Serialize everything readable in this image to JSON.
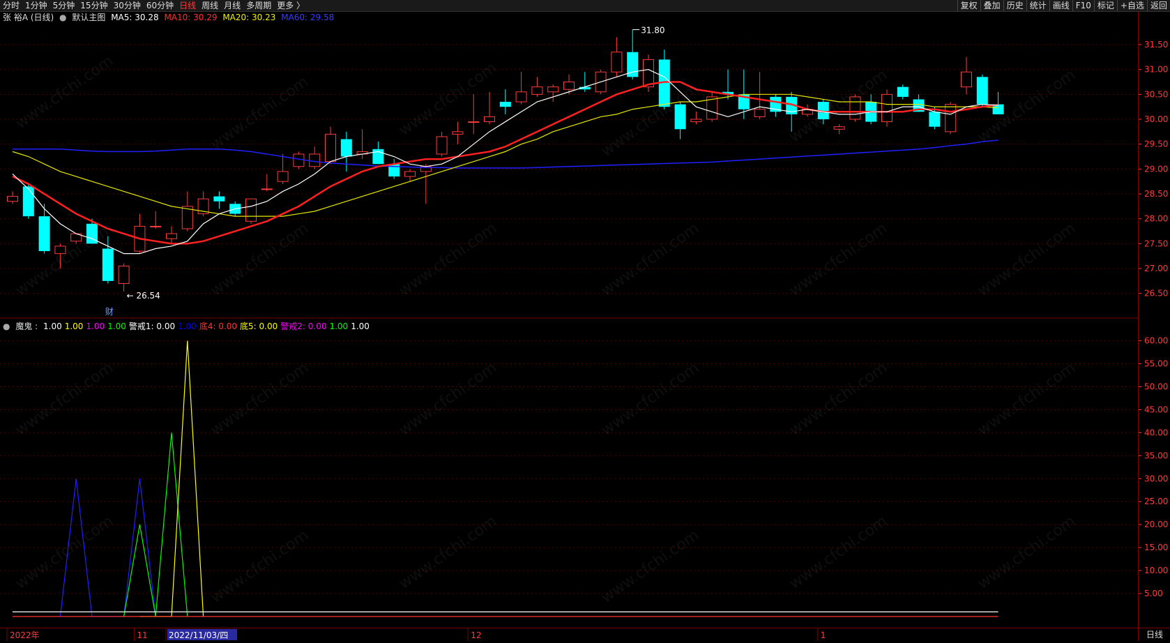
{
  "toolbar": {
    "left_tabs": [
      "分时",
      "1分钟",
      "5分钟",
      "15分钟",
      "30分钟",
      "60分钟",
      "日线",
      "周线",
      "月线",
      "多周期",
      "更多 〉"
    ],
    "active_tab": "日线",
    "right_buttons": [
      "复权",
      "叠加",
      "历史",
      "统计",
      "画线",
      "F10",
      "标记",
      "+自选",
      "返回"
    ]
  },
  "main_legend": {
    "stock": "张 裕A (日线)",
    "template": "默认主图",
    "ma5": "MA5: 30.28",
    "ma10": "MA10: 30.29",
    "ma20": "MA20: 30.23",
    "ma60": "MA60: 29.58"
  },
  "indicator_legend": {
    "name": "魔鬼 :",
    "items": [
      {
        "text": "1.00",
        "color": "#ffffff"
      },
      {
        "text": "1.00",
        "color": "#ffff00"
      },
      {
        "text": "1.00",
        "color": "#ff00ff"
      },
      {
        "text": "1.00",
        "color": "#00ff00"
      },
      {
        "text": "警戒1: 0.00",
        "color": "#ffffff"
      },
      {
        "text": "1.00",
        "color": "#0000ff"
      },
      {
        "text": "底4: 0.00",
        "color": "#ff3333"
      },
      {
        "text": "底5: 0.00",
        "color": "#ffff00"
      },
      {
        "text": "警戒2: 0.00",
        "color": "#ff00ff"
      },
      {
        "text": "1.00",
        "color": "#00ff00"
      },
      {
        "text": "1.00",
        "color": "#ffffff"
      }
    ]
  },
  "colors": {
    "up": "#ff3b3b",
    "down": "#00ffff",
    "ma5": "#ffffff",
    "ma10": "#ff2020",
    "ma20": "#e8e800",
    "ma60": "#2020ff",
    "grid": "#5a0000",
    "axis_text": "#ff3b3b"
  },
  "annotations": {
    "high": "31.80",
    "low": "26.54",
    "fin_marker": "财"
  },
  "watermark": "www.cfchi.com",
  "chart_data": [
    {
      "type": "candlestick",
      "title": "张 裕A (日线)",
      "ylim": [
        26.3,
        31.85
      ],
      "y_ticks": [
        "31.50",
        "31.00",
        "30.50",
        "30.00",
        "29.50",
        "29.00",
        "28.50",
        "28.00",
        "27.50",
        "27.00",
        "26.50"
      ],
      "candles": [
        {
          "o": 28.35,
          "h": 28.55,
          "l": 28.3,
          "c": 28.45
        },
        {
          "o": 28.65,
          "h": 28.7,
          "l": 28.0,
          "c": 28.05
        },
        {
          "o": 28.05,
          "h": 28.3,
          "l": 27.3,
          "c": 27.35
        },
        {
          "o": 27.3,
          "h": 27.5,
          "l": 27.0,
          "c": 27.45
        },
        {
          "o": 27.55,
          "h": 27.7,
          "l": 27.5,
          "c": 27.7
        },
        {
          "o": 27.9,
          "h": 28.0,
          "l": 27.5,
          "c": 27.5
        },
        {
          "o": 27.4,
          "h": 27.65,
          "l": 26.7,
          "c": 26.75
        },
        {
          "o": 26.7,
          "h": 27.1,
          "l": 26.54,
          "c": 27.05
        },
        {
          "o": 27.35,
          "h": 28.1,
          "l": 27.3,
          "c": 27.85
        },
        {
          "o": 27.85,
          "h": 28.15,
          "l": 27.8,
          "c": 27.85
        },
        {
          "o": 27.6,
          "h": 27.85,
          "l": 27.5,
          "c": 27.7
        },
        {
          "o": 27.8,
          "h": 28.55,
          "l": 27.75,
          "c": 28.25
        },
        {
          "o": 28.1,
          "h": 28.55,
          "l": 28.05,
          "c": 28.4
        },
        {
          "o": 28.45,
          "h": 28.55,
          "l": 28.2,
          "c": 28.35
        },
        {
          "o": 28.3,
          "h": 28.35,
          "l": 28.05,
          "c": 28.1
        },
        {
          "o": 27.95,
          "h": 28.4,
          "l": 27.9,
          "c": 28.4
        },
        {
          "o": 28.6,
          "h": 28.9,
          "l": 28.55,
          "c": 28.6
        },
        {
          "o": 28.75,
          "h": 29.3,
          "l": 28.7,
          "c": 28.95
        },
        {
          "o": 29.05,
          "h": 29.35,
          "l": 29.0,
          "c": 29.3
        },
        {
          "o": 29.05,
          "h": 29.45,
          "l": 29.0,
          "c": 29.3
        },
        {
          "o": 29.15,
          "h": 29.85,
          "l": 29.1,
          "c": 29.7
        },
        {
          "o": 29.6,
          "h": 29.75,
          "l": 28.95,
          "c": 29.25
        },
        {
          "o": 29.3,
          "h": 29.8,
          "l": 29.2,
          "c": 29.35
        },
        {
          "o": 29.4,
          "h": 29.55,
          "l": 29.1,
          "c": 29.1
        },
        {
          "o": 29.1,
          "h": 29.2,
          "l": 28.8,
          "c": 28.85
        },
        {
          "o": 28.85,
          "h": 29.0,
          "l": 28.75,
          "c": 28.95
        },
        {
          "o": 28.95,
          "h": 29.1,
          "l": 28.3,
          "c": 29.05
        },
        {
          "o": 29.3,
          "h": 29.75,
          "l": 29.25,
          "c": 29.65
        },
        {
          "o": 29.7,
          "h": 29.95,
          "l": 29.5,
          "c": 29.75
        },
        {
          "o": 29.95,
          "h": 30.5,
          "l": 29.7,
          "c": 29.95
        },
        {
          "o": 29.95,
          "h": 30.55,
          "l": 29.9,
          "c": 30.05
        },
        {
          "o": 30.35,
          "h": 30.6,
          "l": 30.1,
          "c": 30.25
        },
        {
          "o": 30.35,
          "h": 30.95,
          "l": 30.3,
          "c": 30.55
        },
        {
          "o": 30.5,
          "h": 30.85,
          "l": 30.45,
          "c": 30.65
        },
        {
          "o": 30.55,
          "h": 30.7,
          "l": 30.35,
          "c": 30.65
        },
        {
          "o": 30.6,
          "h": 30.9,
          "l": 30.5,
          "c": 30.75
        },
        {
          "o": 30.65,
          "h": 30.95,
          "l": 30.55,
          "c": 30.6
        },
        {
          "o": 30.55,
          "h": 31.0,
          "l": 30.5,
          "c": 30.95
        },
        {
          "o": 30.95,
          "h": 31.65,
          "l": 30.85,
          "c": 31.35
        },
        {
          "o": 31.35,
          "h": 31.8,
          "l": 30.8,
          "c": 30.85
        },
        {
          "o": 30.65,
          "h": 31.3,
          "l": 30.55,
          "c": 31.2
        },
        {
          "o": 31.2,
          "h": 31.4,
          "l": 30.2,
          "c": 30.25
        },
        {
          "o": 30.3,
          "h": 30.35,
          "l": 29.6,
          "c": 29.8
        },
        {
          "o": 29.95,
          "h": 30.15,
          "l": 29.9,
          "c": 30.0
        },
        {
          "o": 30.0,
          "h": 30.55,
          "l": 29.95,
          "c": 30.45
        },
        {
          "o": 30.55,
          "h": 31.0,
          "l": 30.4,
          "c": 30.5
        },
        {
          "o": 30.5,
          "h": 31.0,
          "l": 30.0,
          "c": 30.2
        },
        {
          "o": 30.05,
          "h": 30.95,
          "l": 30.0,
          "c": 30.2
        },
        {
          "o": 30.45,
          "h": 30.5,
          "l": 30.05,
          "c": 30.15
        },
        {
          "o": 30.45,
          "h": 30.55,
          "l": 29.75,
          "c": 30.1
        },
        {
          "o": 30.1,
          "h": 30.3,
          "l": 30.05,
          "c": 30.2
        },
        {
          "o": 30.35,
          "h": 30.4,
          "l": 29.9,
          "c": 30.0
        },
        {
          "o": 29.8,
          "h": 29.9,
          "l": 29.7,
          "c": 29.85
        },
        {
          "o": 30.0,
          "h": 30.5,
          "l": 29.95,
          "c": 30.45
        },
        {
          "o": 30.35,
          "h": 30.5,
          "l": 29.9,
          "c": 29.95
        },
        {
          "o": 29.95,
          "h": 30.6,
          "l": 29.85,
          "c": 30.5
        },
        {
          "o": 30.65,
          "h": 30.7,
          "l": 30.4,
          "c": 30.45
        },
        {
          "o": 30.4,
          "h": 30.5,
          "l": 30.15,
          "c": 30.15
        },
        {
          "o": 30.15,
          "h": 30.25,
          "l": 29.8,
          "c": 29.85
        },
        {
          "o": 29.75,
          "h": 30.35,
          "l": 29.7,
          "c": 30.3
        },
        {
          "o": 30.65,
          "h": 31.25,
          "l": 30.5,
          "c": 30.95
        },
        {
          "o": 30.85,
          "h": 30.9,
          "l": 30.25,
          "c": 30.3
        },
        {
          "o": 30.3,
          "h": 30.55,
          "l": 30.1,
          "c": 30.1
        }
      ],
      "ma5": [
        28.9,
        28.6,
        28.2,
        27.9,
        27.7,
        27.6,
        27.45,
        27.3,
        27.3,
        27.4,
        27.45,
        27.55,
        27.9,
        28.1,
        28.2,
        28.25,
        28.35,
        28.55,
        28.7,
        28.9,
        29.15,
        29.25,
        29.3,
        29.35,
        29.25,
        29.1,
        29.05,
        29.1,
        29.25,
        29.5,
        29.75,
        29.95,
        30.15,
        30.35,
        30.45,
        30.55,
        30.65,
        30.75,
        30.85,
        30.95,
        31.0,
        30.85,
        30.55,
        30.25,
        30.15,
        30.05,
        30.15,
        30.25,
        30.2,
        30.15,
        30.2,
        30.15,
        30.1,
        30.1,
        30.15,
        30.15,
        30.25,
        30.25,
        30.15,
        30.1,
        30.25,
        30.3,
        30.28
      ],
      "ma10": [
        28.85,
        28.7,
        28.5,
        28.3,
        28.1,
        27.95,
        27.8,
        27.7,
        27.6,
        27.55,
        27.5,
        27.5,
        27.55,
        27.65,
        27.75,
        27.85,
        27.95,
        28.1,
        28.25,
        28.45,
        28.65,
        28.8,
        28.95,
        29.05,
        29.1,
        29.15,
        29.2,
        29.2,
        29.25,
        29.3,
        29.35,
        29.45,
        29.6,
        29.75,
        29.9,
        30.05,
        30.2,
        30.35,
        30.5,
        30.6,
        30.7,
        30.75,
        30.75,
        30.6,
        30.55,
        30.5,
        30.45,
        30.4,
        30.35,
        30.3,
        30.2,
        30.15,
        30.15,
        30.15,
        30.15,
        30.15,
        30.15,
        30.2,
        30.2,
        30.15,
        30.2,
        30.25,
        30.29
      ],
      "ma20": [
        29.35,
        29.25,
        29.1,
        28.95,
        28.85,
        28.75,
        28.65,
        28.55,
        28.45,
        28.35,
        28.25,
        28.2,
        28.15,
        28.1,
        28.05,
        28.05,
        28.05,
        28.05,
        28.1,
        28.15,
        28.25,
        28.35,
        28.45,
        28.55,
        28.65,
        28.75,
        28.85,
        28.95,
        29.05,
        29.15,
        29.25,
        29.35,
        29.5,
        29.6,
        29.75,
        29.85,
        29.95,
        30.05,
        30.1,
        30.2,
        30.25,
        30.3,
        30.35,
        30.35,
        30.4,
        30.45,
        30.5,
        30.5,
        30.5,
        30.5,
        30.45,
        30.4,
        30.35,
        30.35,
        30.35,
        30.3,
        30.3,
        30.3,
        30.25,
        30.25,
        30.25,
        30.25,
        30.23
      ],
      "ma60": [
        29.4,
        29.4,
        29.4,
        29.4,
        29.38,
        29.36,
        29.35,
        29.35,
        29.35,
        29.36,
        29.38,
        29.4,
        29.4,
        29.4,
        29.38,
        29.35,
        29.3,
        29.25,
        29.2,
        29.15,
        29.12,
        29.1,
        29.08,
        29.06,
        29.05,
        29.04,
        29.03,
        29.03,
        29.02,
        29.02,
        29.02,
        29.02,
        29.02,
        29.03,
        29.04,
        29.05,
        29.06,
        29.07,
        29.08,
        29.09,
        29.1,
        29.11,
        29.12,
        29.13,
        29.14,
        29.16,
        29.18,
        29.2,
        29.22,
        29.24,
        29.26,
        29.28,
        29.3,
        29.32,
        29.34,
        29.36,
        29.38,
        29.4,
        29.43,
        29.47,
        29.5,
        29.55,
        29.58
      ]
    },
    {
      "type": "line",
      "title": "魔鬼",
      "ylim": [
        0,
        61
      ],
      "y_ticks": [
        "60.00",
        "55.00",
        "50.00",
        "45.00",
        "40.00",
        "35.00",
        "30.00",
        "25.00",
        "20.00",
        "15.00",
        "10.00",
        "5.00"
      ],
      "series": [
        {
          "color": "#2020ff",
          "points": [
            [
              3,
              0
            ],
            [
              4,
              30
            ],
            [
              5,
              0
            ],
            [
              7,
              0
            ],
            [
              8,
              30
            ],
            [
              9,
              0
            ]
          ]
        },
        {
          "color": "#00ff00",
          "points": [
            [
              7,
              0
            ],
            [
              8,
              20
            ],
            [
              9,
              0
            ],
            [
              10,
              40
            ],
            [
              11,
              0
            ]
          ]
        },
        {
          "color": "#ffff00",
          "points": [
            [
              8,
              0
            ],
            [
              9,
              0
            ],
            [
              10,
              0
            ],
            [
              11,
              60
            ],
            [
              12,
              0
            ]
          ]
        },
        {
          "color": "#ffffff",
          "points": [
            [
              0,
              1
            ],
            [
              62,
              1
            ]
          ]
        },
        {
          "color": "#ff3333",
          "points": [
            [
              0,
              0
            ],
            [
              62,
              0
            ]
          ]
        }
      ]
    }
  ],
  "date_axis": [
    {
      "label": "2022年",
      "idx": 0,
      "color": "#ff3b3b"
    },
    {
      "label": "11",
      "idx": 8,
      "color": "#ff3b3b"
    },
    {
      "label": "2022/11/03/四",
      "idx": 10,
      "color": "#ffffff",
      "highlight": true
    },
    {
      "label": "12",
      "idx": 29,
      "color": "#ff3b3b"
    },
    {
      "label": "1",
      "idx": 51,
      "color": "#ff3b3b"
    }
  ],
  "period_label": "日线"
}
